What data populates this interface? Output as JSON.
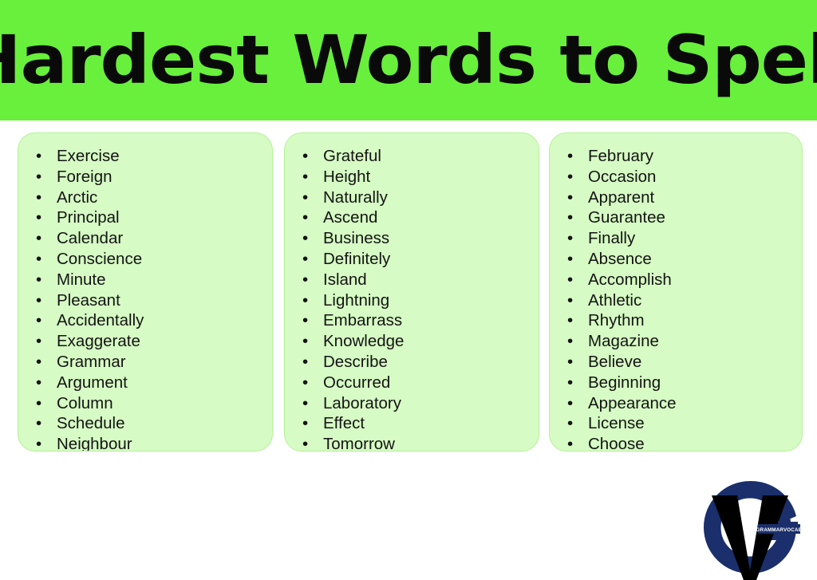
{
  "header": {
    "title": "Hardest Words to Spell",
    "background_color": "#68f03c",
    "title_color": "#0a0a0a"
  },
  "theme": {
    "page_background": "#ffffff",
    "card_background": "#d6fbc4",
    "card_border": "#b4f297",
    "text_color": "#141414",
    "logo_navy": "#1a2f6b",
    "logo_black": "#000000"
  },
  "columns": [
    {
      "id": "column-1",
      "bullet": "•",
      "items": [
        "Exercise",
        "Foreign",
        "Arctic",
        "Principal",
        "Calendar",
        "Conscience",
        "Minute",
        "Pleasant",
        "Accidentally",
        "Exaggerate",
        "Grammar",
        "Argument",
        "Column",
        "Schedule",
        "Neighbour"
      ]
    },
    {
      "id": "column-2",
      "bullet": "•",
      "items": [
        "Grateful",
        "Height",
        "Naturally",
        "Ascend",
        "Business",
        "Definitely",
        "Island",
        "Lightning",
        "Embarrass",
        "Knowledge",
        "Describe",
        "Occurred",
        "Laboratory",
        "Effect",
        "Tomorrow"
      ]
    },
    {
      "id": "column-3",
      "bullet": "•",
      "items": [
        "February",
        "Occasion",
        "Apparent",
        "Guarantee",
        "Finally",
        "Absence",
        "Accomplish",
        "Athletic",
        "Rhythm",
        "Magazine",
        "Believe",
        "Beginning",
        "Appearance",
        "License",
        "Choose"
      ]
    }
  ],
  "logo": {
    "name": "grammarvocab-logo",
    "label": "GRAMMARVOCAB"
  }
}
